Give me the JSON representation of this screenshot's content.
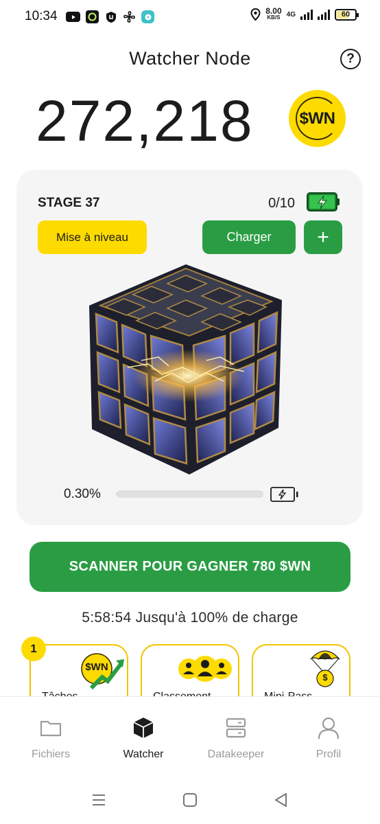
{
  "status_bar": {
    "time": "10:34",
    "speed_value": "8.00",
    "speed_unit": "KB/S",
    "network": "4G",
    "battery": "60",
    "icons": [
      "youtube-icon",
      "app-icon",
      "shield-app-icon",
      "fan-icon",
      "chat-icon",
      "location-icon",
      "signal-icon"
    ]
  },
  "header": {
    "title": "Watcher Node",
    "help": "?"
  },
  "balance": {
    "amount": "272,218",
    "currency": "$WN"
  },
  "stage_card": {
    "stage": "STAGE 37",
    "count": "0/10",
    "upgrade_label": "Mise à niveau",
    "charge_label": "Charger",
    "plus_label": "+",
    "progress_label": "0.30%",
    "progress_value": 0.3
  },
  "scan_button": {
    "label": "SCANNER POUR GAGNER 780 $WN"
  },
  "timer": {
    "text": "5:58:54 Jusqu'à 100% de charge"
  },
  "feature_cards": [
    {
      "badge": "1",
      "coin": "$WN",
      "label": "Tâches"
    },
    {
      "label": "Classement"
    },
    {
      "coin": "$",
      "label": "Mini-Pass"
    }
  ],
  "bottom_nav": [
    {
      "label": "Fichiers",
      "icon": "folder-icon",
      "active": false
    },
    {
      "label": "Watcher",
      "icon": "cube-icon",
      "active": true
    },
    {
      "label": "Datakeeper",
      "icon": "server-icon",
      "active": false
    },
    {
      "label": "Profil",
      "icon": "user-icon",
      "active": false
    }
  ],
  "colors": {
    "primary_green": "#2a9d44",
    "accent_yellow": "#fddb00",
    "card_bg": "#f5f5f5"
  }
}
